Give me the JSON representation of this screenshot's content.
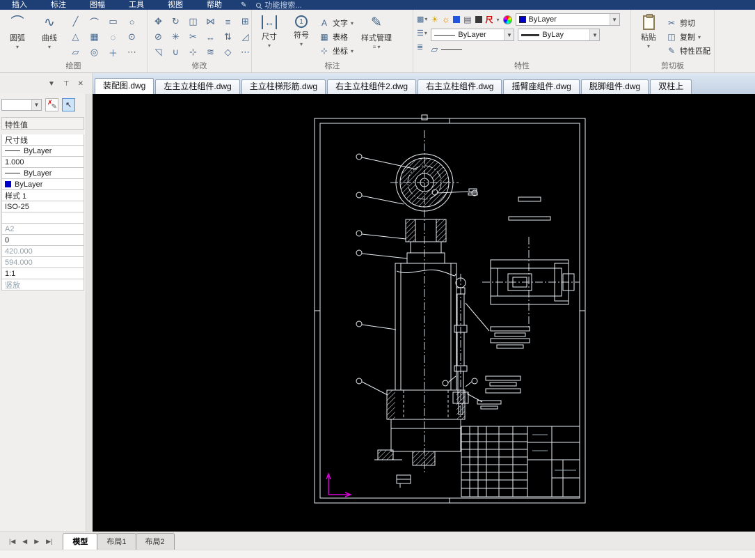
{
  "app": {
    "menubar": {
      "items": [
        "插入",
        "标注",
        "图幅",
        "工具",
        "视图",
        "帮助"
      ],
      "search_placeholder": "功能搜索..."
    },
    "ribbon": {
      "draw": {
        "label": "绘图",
        "arc": "圆弧",
        "spline": "曲线"
      },
      "modify": {
        "label": "修改"
      },
      "annotate": {
        "label": "标注",
        "dimension": "尺寸",
        "symbol": "符号",
        "symbol_icon_text": "1",
        "text": "文字",
        "text_icon": "A",
        "table": "表格",
        "coordinate": "坐标",
        "style_manager": "样式管理"
      },
      "properties": {
        "label": "特性",
        "color": "ByLayer",
        "linetype": "ByLayer",
        "lineweight": "ByLay",
        "dim_badge": "尺"
      },
      "clipboard": {
        "label": "剪切板",
        "paste": "粘贴",
        "cut": "剪切",
        "copy": "复制",
        "match": "特性匹配"
      }
    },
    "document_tabs": [
      {
        "label": "装配图.dwg"
      },
      {
        "label": "左主立柱组件.dwg"
      },
      {
        "label": "主立柱梯形筋.dwg"
      },
      {
        "label": "右主立柱组件2.dwg"
      },
      {
        "label": "右主立柱组件.dwg"
      },
      {
        "label": "摇臂座组件.dwg"
      },
      {
        "label": "脱脚组件.dwg"
      },
      {
        "label": "双柱上"
      }
    ],
    "palette": {
      "header": "特性值",
      "rows": [
        {
          "value": "尺寸线",
          "swatch": "none",
          "muted": false
        },
        {
          "value": "ByLayer",
          "swatch": "line",
          "muted": false
        },
        {
          "value": "1.000",
          "swatch": "none",
          "muted": false
        },
        {
          "value": "ByLayer",
          "swatch": "line",
          "muted": false
        },
        {
          "value": "ByLayer",
          "swatch": "blue",
          "muted": false
        },
        {
          "value": "样式 1",
          "swatch": "none",
          "muted": false
        },
        {
          "value": "ISO-25",
          "swatch": "none",
          "muted": false
        },
        {
          "value": "",
          "swatch": "none",
          "muted": false
        },
        {
          "value": "A2",
          "swatch": "none",
          "muted": true
        },
        {
          "value": "0",
          "swatch": "none",
          "muted": false
        },
        {
          "value": "420.000",
          "swatch": "none",
          "muted": true
        },
        {
          "value": "594.000",
          "swatch": "none",
          "muted": true
        },
        {
          "value": "1:1",
          "swatch": "none",
          "muted": false
        },
        {
          "value": "竖放",
          "swatch": "none",
          "muted": true
        }
      ]
    },
    "layout_bar": {
      "nav": [
        "|◀",
        "◀",
        "▶",
        "▶|"
      ],
      "tabs": [
        {
          "label": "模型",
          "active": true
        },
        {
          "label": "布局1",
          "active": false
        },
        {
          "label": "布局2",
          "active": false
        }
      ]
    },
    "colors": {
      "menubar_bg": "#1d3f75",
      "bylayer_blue": "#0000cd",
      "ucs_magenta": "#d400d4",
      "canvas_bg": "#000000"
    }
  }
}
